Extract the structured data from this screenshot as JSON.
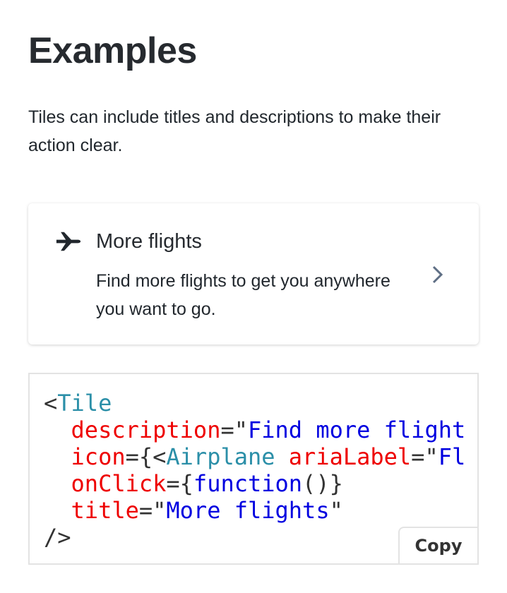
{
  "heading": "Examples",
  "intro": "Tiles can include titles and descriptions to make their action clear.",
  "tile": {
    "icon": "airplane-icon",
    "title": "More flights",
    "description": "Find more flights to get you anywhere you want to go.",
    "chevron": "chevron-right-icon"
  },
  "code": {
    "lines": [
      [
        [
          "punc",
          "<"
        ],
        [
          "tag",
          "Tile"
        ]
      ],
      [
        [
          "punc",
          "  "
        ],
        [
          "attr",
          "description"
        ],
        [
          "punc",
          "=\""
        ],
        [
          "str",
          "Find more flight"
        ]
      ],
      [
        [
          "punc",
          "  "
        ],
        [
          "attr",
          "icon"
        ],
        [
          "punc",
          "={<"
        ],
        [
          "tag",
          "Airplane"
        ],
        [
          "punc",
          " "
        ],
        [
          "attr",
          "ariaLabel"
        ],
        [
          "punc",
          "=\""
        ],
        [
          "str",
          "Fl"
        ]
      ],
      [
        [
          "punc",
          "  "
        ],
        [
          "attr",
          "onClick"
        ],
        [
          "punc",
          "={"
        ],
        [
          "str",
          "function"
        ],
        [
          "punc",
          "()}"
        ]
      ],
      [
        [
          "punc",
          "  "
        ],
        [
          "attr",
          "title"
        ],
        [
          "punc",
          "=\""
        ],
        [
          "str",
          "More flights"
        ],
        [
          "punc",
          "\""
        ]
      ],
      [
        [
          "punc",
          "/>"
        ]
      ]
    ],
    "copy_label": "Copy"
  },
  "colors": {
    "tag": "#2b8fa8",
    "attr": "#ee0000",
    "string": "#0000e0",
    "chevron": "#5f6f85"
  }
}
